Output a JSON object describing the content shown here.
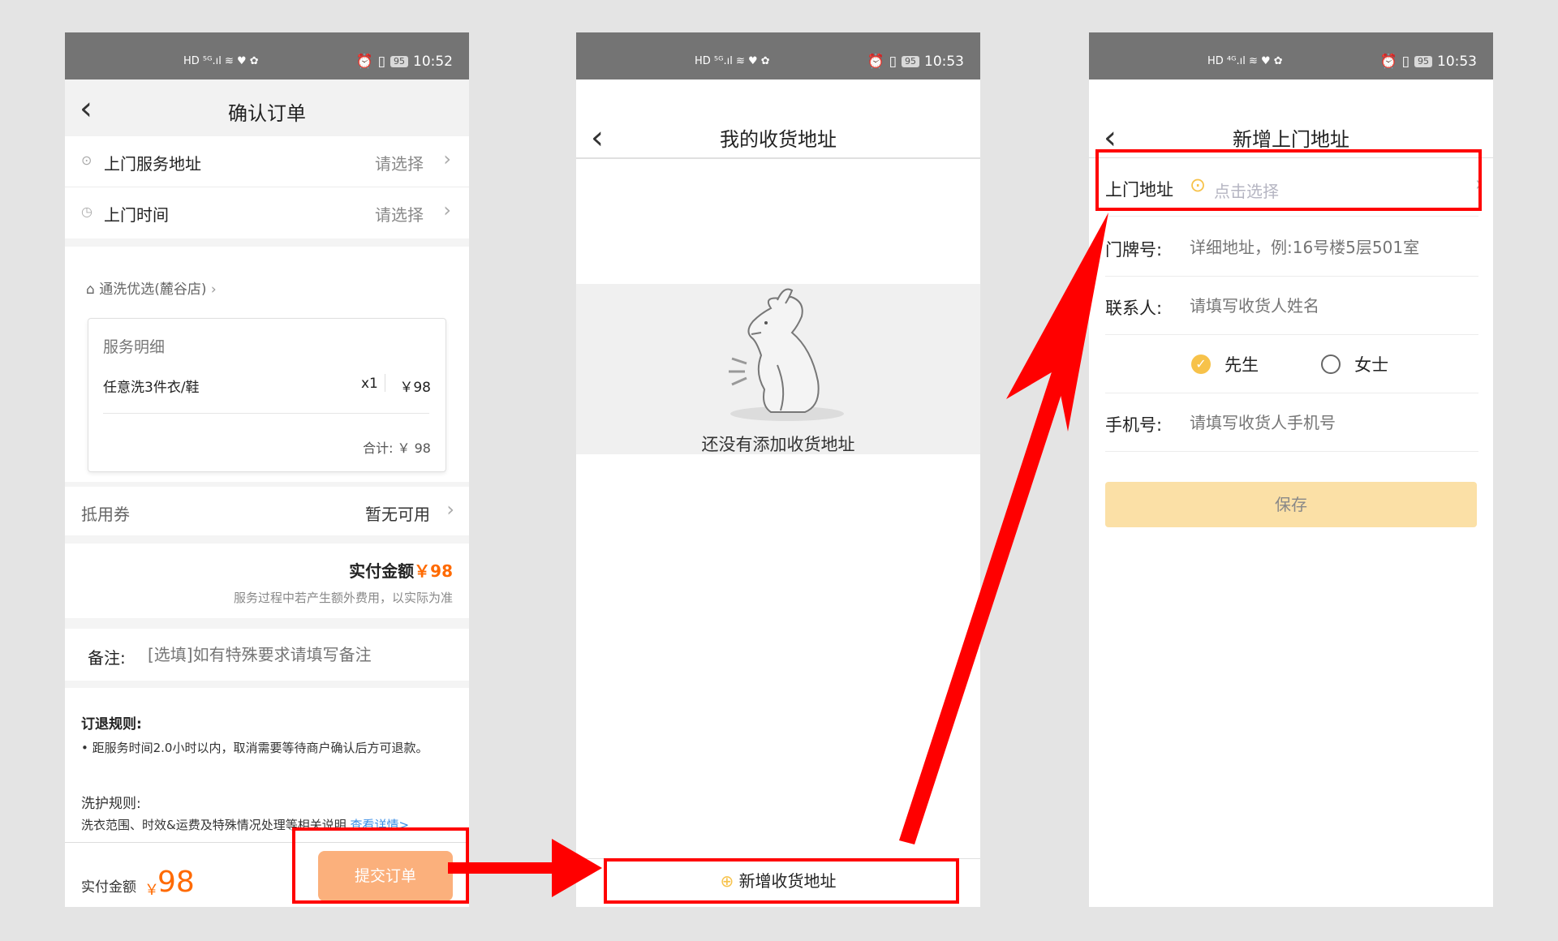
{
  "screens": [
    {
      "status": {
        "left_icons": "HD ⁵ᴳ.ıl ≋  ♥ ✿",
        "time": "10:52",
        "battery": "95"
      },
      "title": "确认订单",
      "address_label": "上门服务地址",
      "address_value": "请选择",
      "time_label": "上门时间",
      "time_value": "请选择",
      "store_name": "通洗优选(麓谷店)",
      "detail_title": "服务明细",
      "item_name": "任意洗3件衣/鞋",
      "item_qty": "x1",
      "item_price": "￥98",
      "subtotal": "合计: ￥ 98",
      "coupon_label": "抵用券",
      "coupon_value": "暂无可用",
      "pay_label": "实付金额",
      "pay_amount": "￥98",
      "pay_note": "服务过程中若产生额外费用，以实际为准",
      "remark_label": "备注:",
      "remark_placeholder": "[选填]如有特殊要求请填写备注",
      "refund_title": "订退规则:",
      "refund_text": "距服务时间2.0小时以内，取消需要等待商户确认后方可退款。",
      "wash_title": "洗护规则:",
      "wash_text": "洗衣范围、时效&运费及特殊情况处理等相关说明",
      "wash_link": "查看详情>",
      "bottom_label": "实付金额",
      "bottom_currency": "￥",
      "bottom_amount": "98",
      "submit_label": "提交订单"
    },
    {
      "status": {
        "left_icons": "HD ⁵ᴳ.ıl ≋  ♥ ✿",
        "time": "10:53",
        "battery": "95"
      },
      "title": "我的收货地址",
      "empty_text": "还没有添加收货地址",
      "add_label": "新增收货地址"
    },
    {
      "status": {
        "left_icons": "HD ⁴ᴳ.ıl ≋  ♥ ✿",
        "time": "10:53",
        "battery": "95"
      },
      "title": "新增上门地址",
      "address_label": "上门地址",
      "address_placeholder": "点击选择",
      "door_label": "门牌号:",
      "door_placeholder": "详细地址，例:16号楼5层501室",
      "contact_label": "联系人:",
      "contact_placeholder": "请填写收货人姓名",
      "gender_male": "先生",
      "gender_female": "女士",
      "phone_label": "手机号:",
      "phone_placeholder": "请填写收货人手机号",
      "save_label": "保存"
    }
  ],
  "colors": {
    "accent_orange": "#ff6a00",
    "submit_button": "#fbb07c",
    "save_button": "#fbe0a6",
    "radio_selected": "#f7c24a",
    "annotation_red": "#ff0000",
    "link_blue": "#3a8ee6"
  }
}
